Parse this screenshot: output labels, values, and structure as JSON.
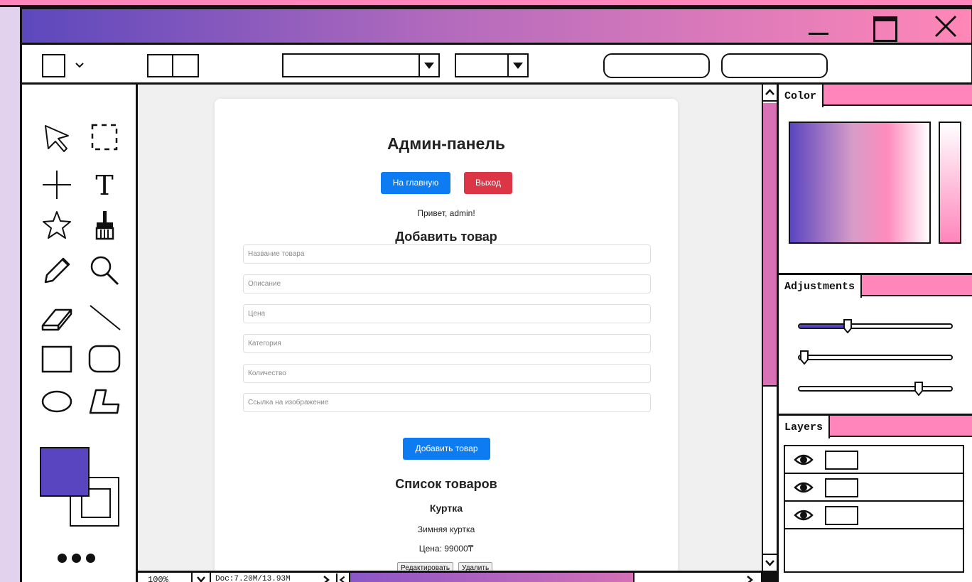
{
  "app": {
    "panels": {
      "color": "Color",
      "adjustments": "Adjustments",
      "layers": "Layers"
    },
    "status": {
      "zoom": "100%",
      "doc": "Doc:7.20M/13.93M"
    },
    "colors": {
      "accent_purple": "#5a45c0",
      "accent_pink": "#ff85bb",
      "foreground_color": "#5a45c0",
      "background_color": "#ffffff"
    },
    "adjustments": [
      {
        "level": 0.32
      },
      {
        "level": 0.04
      },
      {
        "level": 0.78
      }
    ],
    "layers_count": 3
  },
  "webpage": {
    "title": "Админ-панель",
    "home_button": "На главную",
    "logout_button": "Выход",
    "greeting": "Привет, admin!",
    "add_heading": "Добавить товар",
    "fields": [
      {
        "placeholder": "Название товара"
      },
      {
        "placeholder": "Описание"
      },
      {
        "placeholder": "Цена"
      },
      {
        "placeholder": "Категория"
      },
      {
        "placeholder": "Количество"
      },
      {
        "placeholder": "Ссылка на изображение"
      }
    ],
    "add_button": "Добавить товар",
    "list_heading": "Список товаров",
    "product": {
      "name": "Куртка",
      "description": "Зимняя куртка",
      "price": "Цена: 99000₸",
      "edit_button": "Редактировать",
      "delete_button": "Удалить"
    },
    "button_colors": {
      "primary": "#0d7cf2",
      "danger": "#dc3545"
    }
  }
}
